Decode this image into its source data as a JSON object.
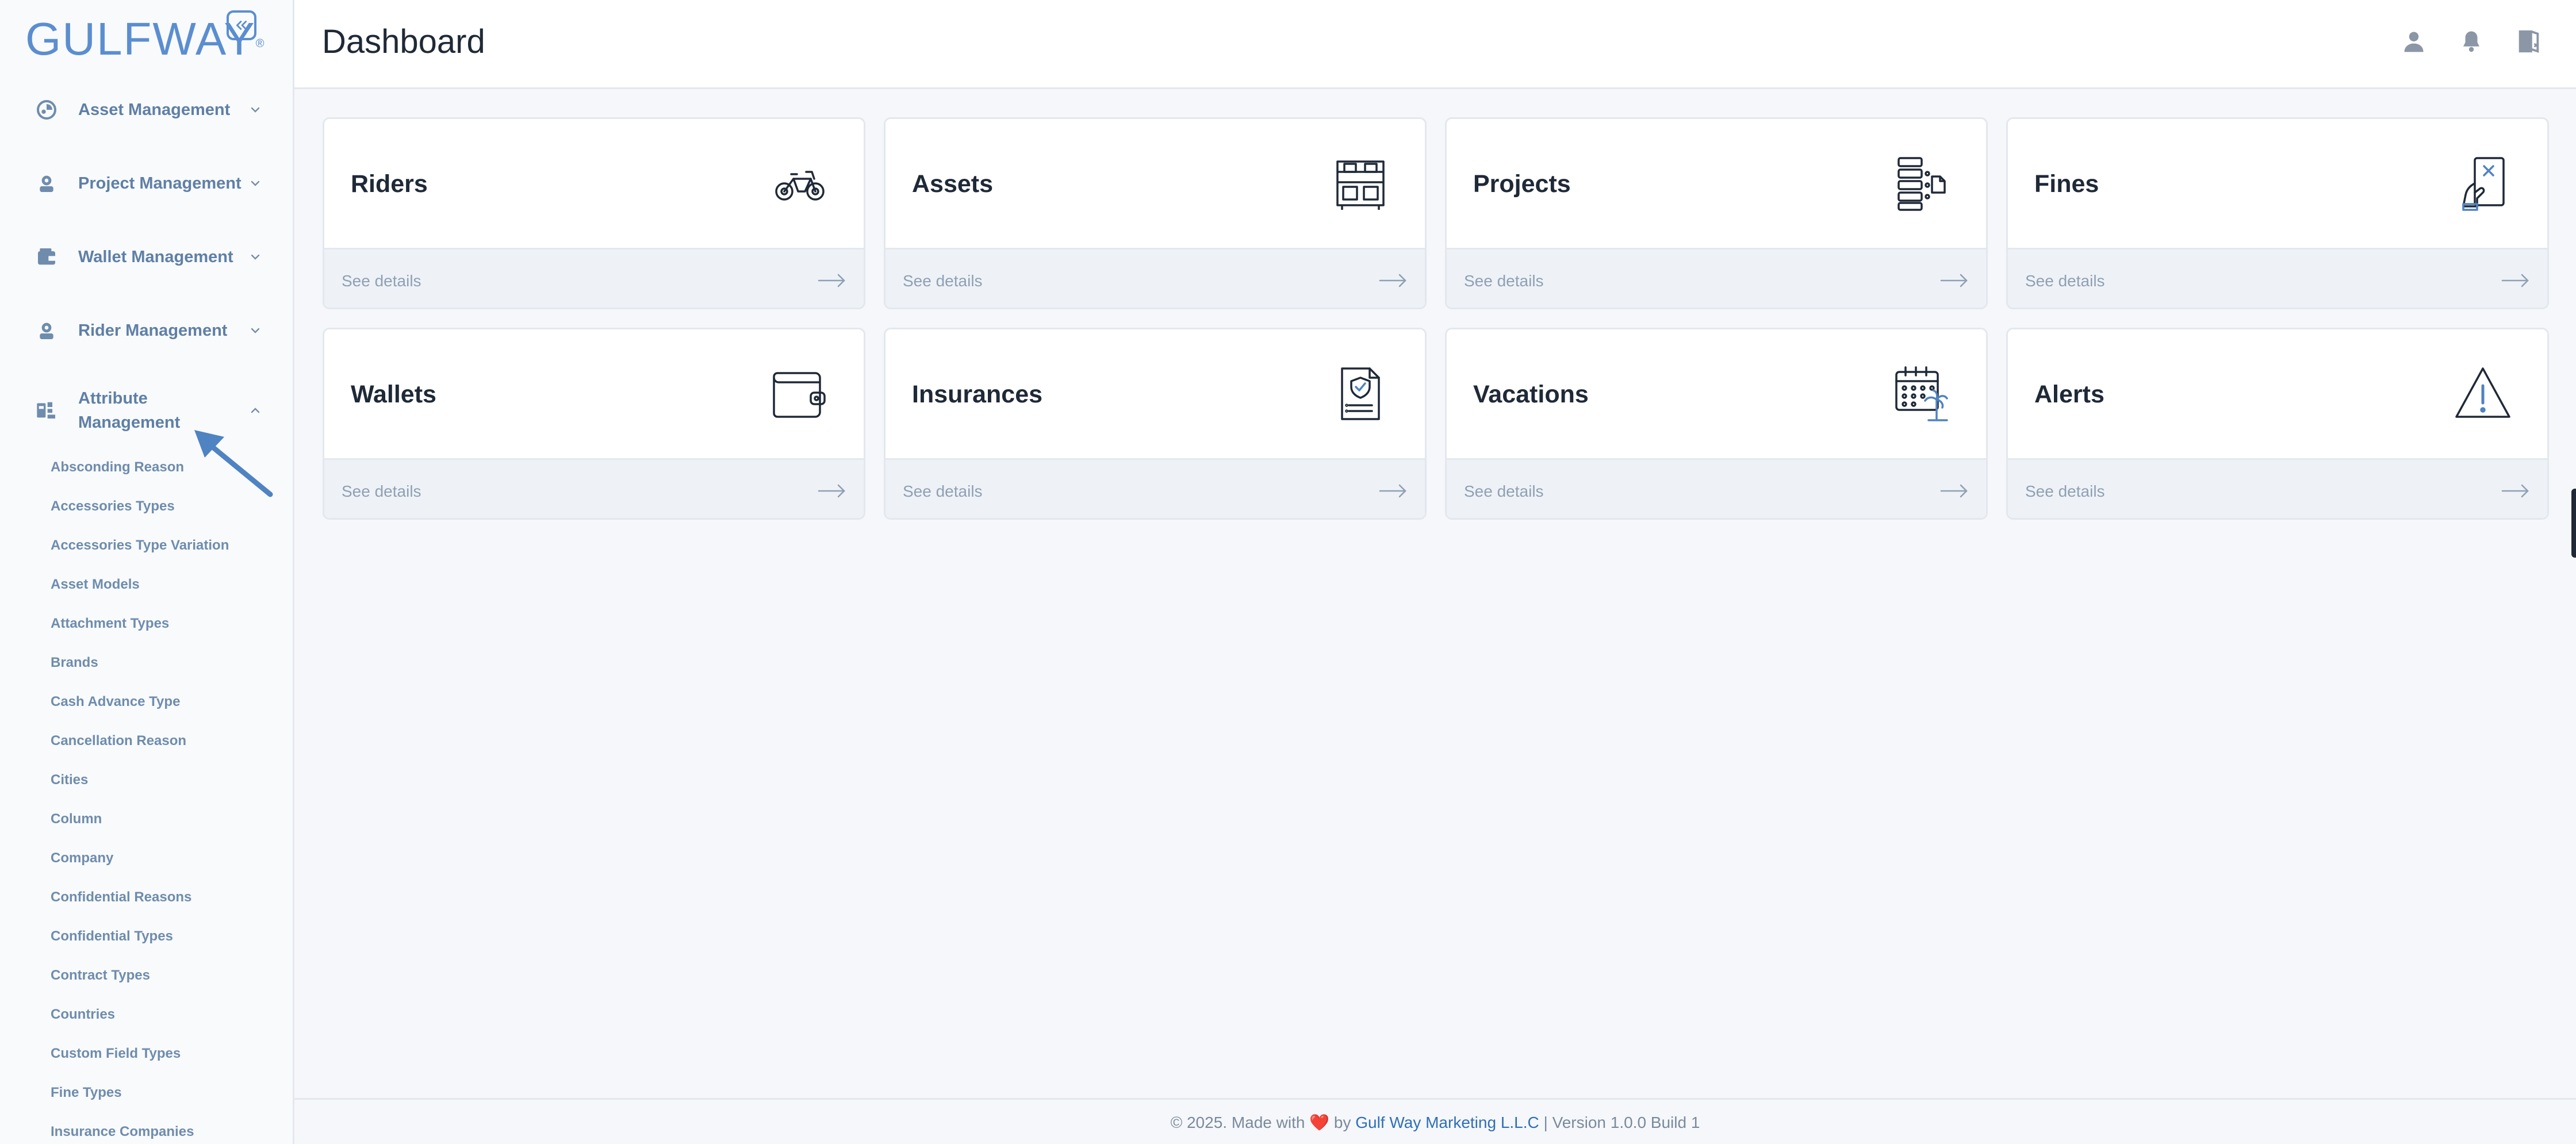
{
  "app": {
    "logo_text": "GULFWAY",
    "logo_mark": "®"
  },
  "sidebar": {
    "items": [
      {
        "label": "Asset Management",
        "icon": "asset-icon"
      },
      {
        "label": "Project Management",
        "icon": "project-icon"
      },
      {
        "label": "Wallet Management",
        "icon": "wallet-icon"
      },
      {
        "label": "Rider Management",
        "icon": "rider-icon"
      },
      {
        "label": "Attribute Management",
        "label_line1": "Attribute",
        "label_line2": "Management",
        "icon": "attribute-icon",
        "expanded": true
      }
    ],
    "sub_items": [
      "Absconding Reason",
      "Accessories Types",
      "Accessories Type Variation",
      "Asset Models",
      "Attachment Types",
      "Brands",
      "Cash Advance Type",
      "Cancellation Reason",
      "Cities",
      "Column",
      "Company",
      "Confidential Reasons",
      "Confidential Types",
      "Contract Types",
      "Countries",
      "Custom Field Types",
      "Fine Types",
      "Insurance Companies"
    ]
  },
  "header": {
    "title": "Dashboard"
  },
  "cards": [
    {
      "title": "Riders",
      "link": "See details",
      "icon": "bicycle-icon"
    },
    {
      "title": "Assets",
      "link": "See details",
      "icon": "shelf-icon"
    },
    {
      "title": "Projects",
      "link": "See details",
      "icon": "checklist-icon"
    },
    {
      "title": "Fines",
      "link": "See details",
      "icon": "fine-card-icon"
    },
    {
      "title": "Wallets",
      "link": "See details",
      "icon": "wallet-icon"
    },
    {
      "title": "Insurances",
      "link": "See details",
      "icon": "insurance-document-icon"
    },
    {
      "title": "Vacations",
      "link": "See details",
      "icon": "calendar-palm-icon"
    },
    {
      "title": "Alerts",
      "link": "See details",
      "icon": "warning-icon"
    }
  ],
  "footer": {
    "prefix": "© 2025. Made with",
    "heart": "❤️",
    "by": "by",
    "company": "Gulf Way Marketing L.L.C",
    "suffix": "| Version 1.0.0 Build 1"
  },
  "colors": {
    "accent": "#5b8ed0",
    "sidebar_text": "#5f7fa6",
    "background": "#f5f7fa",
    "link": "#2f6fb5"
  }
}
